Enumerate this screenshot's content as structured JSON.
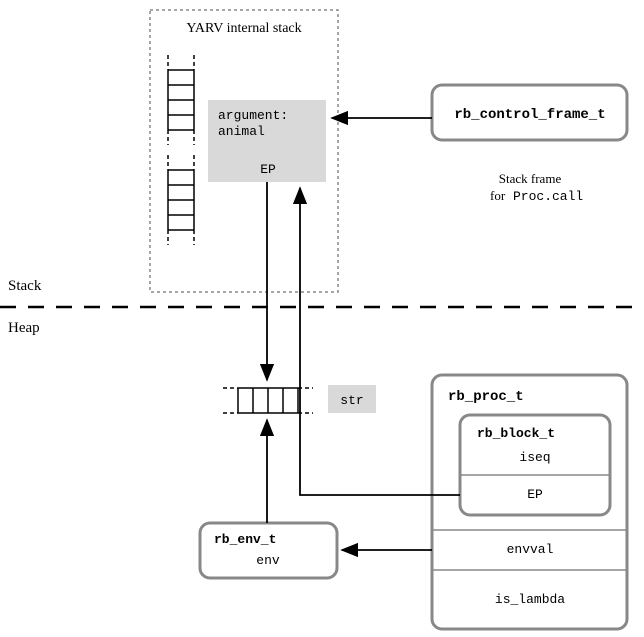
{
  "labels": {
    "stack": "Stack",
    "heap": "Heap",
    "yarv_title": "YARV internal stack",
    "argument_line1": "argument:",
    "argument_line2": "animal",
    "ep_small": "EP",
    "rb_control_frame_t": "rb_control_frame_t",
    "stack_frame_line1": "Stack frame",
    "stack_frame_line2": "for",
    "proc_call": "Proc.call",
    "str_box": "str",
    "rb_proc_t": "rb_proc_t",
    "rb_block_t": "rb_block_t",
    "iseq": "iseq",
    "ep_block": "EP",
    "envval": "envval",
    "is_lambda": "is_lambda",
    "rb_env_t": "rb_env_t",
    "env": "env"
  }
}
